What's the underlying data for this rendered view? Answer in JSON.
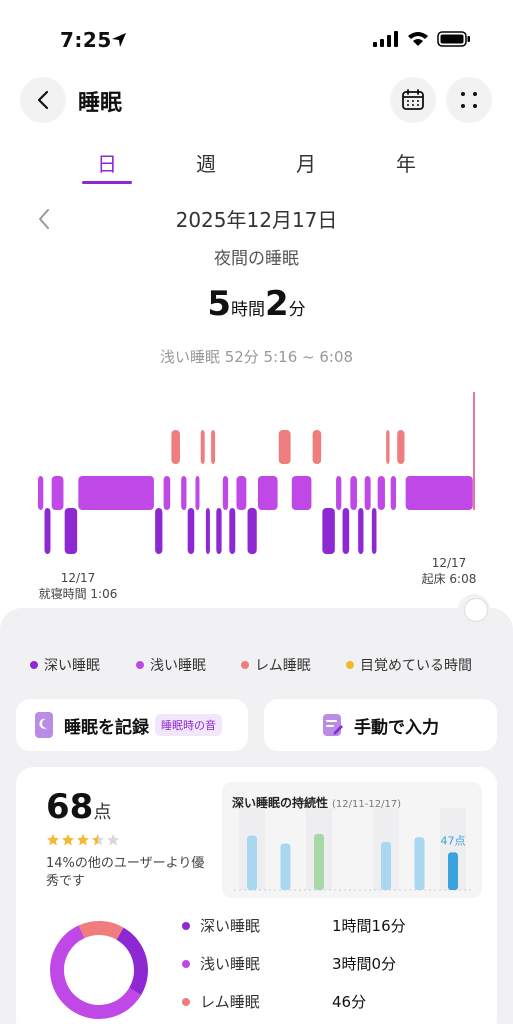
{
  "status": {
    "time": "7:25"
  },
  "header": {
    "title": "睡眠"
  },
  "tabs": [
    "日",
    "週",
    "月",
    "年"
  ],
  "date": "2025年12月17日",
  "subtitle": "夜間の睡眠",
  "duration": {
    "hours": "5",
    "hours_unit": "時間",
    "minutes": "2",
    "minutes_unit": "分"
  },
  "selection": "浅い睡眠 52分 5:16 ~ 6:08",
  "chart_data": {
    "type": "bar",
    "x_unit": "hours since bedtime (01:06)",
    "levels": [
      "深い睡眠",
      "浅い睡眠",
      "レム睡眠"
    ],
    "start": {
      "date": "12/17",
      "label": "就寝時間 1:06"
    },
    "end": {
      "date": "12/17",
      "label": "起床 6:08"
    },
    "segments": [
      {
        "stage": "light",
        "from": 0.0,
        "to": 0.1
      },
      {
        "stage": "deep",
        "from": 0.1,
        "to": 0.21
      },
      {
        "stage": "light",
        "from": 0.21,
        "to": 0.41
      },
      {
        "stage": "deep",
        "from": 0.41,
        "to": 0.62
      },
      {
        "stage": "light",
        "from": 0.62,
        "to": 1.8
      },
      {
        "stage": "deep",
        "from": 1.8,
        "to": 1.93
      },
      {
        "stage": "light",
        "from": 1.93,
        "to": 2.05
      },
      {
        "stage": "rem",
        "from": 2.05,
        "to": 2.2
      },
      {
        "stage": "light",
        "from": 2.2,
        "to": 2.3
      },
      {
        "stage": "deep",
        "from": 2.3,
        "to": 2.42
      },
      {
        "stage": "light",
        "from": 2.42,
        "to": 2.5
      },
      {
        "stage": "rem",
        "from": 2.5,
        "to": 2.58
      },
      {
        "stage": "deep",
        "from": 2.58,
        "to": 2.66
      },
      {
        "stage": "rem",
        "from": 2.66,
        "to": 2.74
      },
      {
        "stage": "deep",
        "from": 2.74,
        "to": 2.84
      },
      {
        "stage": "light",
        "from": 2.84,
        "to": 2.94
      },
      {
        "stage": "deep",
        "from": 2.94,
        "to": 3.05
      },
      {
        "stage": "light",
        "from": 3.05,
        "to": 3.22
      },
      {
        "stage": "deep",
        "from": 3.22,
        "to": 3.38
      },
      {
        "stage": "light",
        "from": 3.38,
        "to": 3.7
      },
      {
        "stage": "rem",
        "from": 3.7,
        "to": 3.9
      },
      {
        "stage": "light",
        "from": 3.9,
        "to": 4.22
      },
      {
        "stage": "rem",
        "from": 4.22,
        "to": 4.37
      },
      {
        "stage": "deep",
        "from": 4.37,
        "to": 4.58
      },
      {
        "stage": "light",
        "from": 4.58,
        "to": 4.68
      },
      {
        "stage": "deep",
        "from": 4.68,
        "to": 4.8
      },
      {
        "stage": "light",
        "from": 4.8,
        "to": 4.92
      },
      {
        "stage": "deep",
        "from": 4.92,
        "to": 5.02
      },
      {
        "stage": "light",
        "from": 5.02,
        "to": 5.13
      },
      {
        "stage": "deep",
        "from": 5.13,
        "to": 5.22
      },
      {
        "stage": "light",
        "from": 5.22,
        "to": 5.35
      },
      {
        "stage": "rem",
        "from": 5.35,
        "to": 5.42
      },
      {
        "stage": "light",
        "from": 5.42,
        "to": 5.52
      },
      {
        "stage": "rem",
        "from": 5.52,
        "to": 5.65
      },
      {
        "stage": "light",
        "from": 5.65,
        "to": 6.7
      }
    ],
    "total_hours": 6.7
  },
  "legend": [
    {
      "label": "深い睡眠",
      "color": "#8e28d2"
    },
    {
      "label": "浅い睡眠",
      "color": "#c048e6"
    },
    {
      "label": "レム睡眠",
      "color": "#f07d7d"
    },
    {
      "label": "目覚めている時間",
      "color": "#f5b82e"
    }
  ],
  "actions": {
    "record_label": "睡眠を記録",
    "record_chip": "睡眠時の音",
    "manual_label": "手動で入力"
  },
  "score": {
    "value": "68",
    "unit": "点",
    "stars": 3.5,
    "rank_text": "14%の他のユーザーより優秀です"
  },
  "continuity": {
    "title": "深い睡眠の持続性",
    "range": "(12/11-12/17)",
    "values": [
      68,
      58,
      70,
      0,
      60,
      66,
      47
    ],
    "highlight_index": 6,
    "highlight_label": "47点",
    "colors": [
      "#a9d7f0",
      "#a9d7f0",
      "#a8d8a8",
      "#a9d7f0",
      "#a9d7f0",
      "#a9d7f0",
      "#3aa3dc"
    ]
  },
  "breakdown": [
    {
      "label": "深い睡眠",
      "value": "1時間16分",
      "color": "#8e28d2",
      "minutes": 76
    },
    {
      "label": "浅い睡眠",
      "value": "3時間0分",
      "color": "#c048e6",
      "minutes": 180
    },
    {
      "label": "レム睡眠",
      "value": "46分",
      "color": "#f07d7d",
      "minutes": 46
    }
  ]
}
